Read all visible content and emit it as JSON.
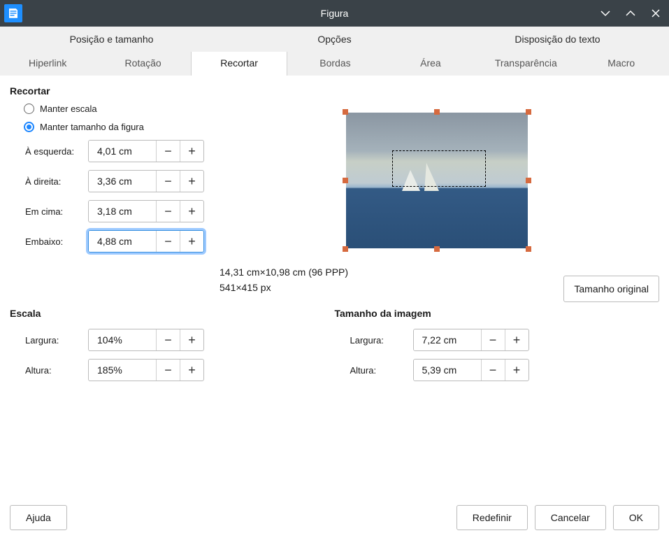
{
  "window": {
    "title": "Figura"
  },
  "tabs": {
    "row1": [
      "Posição e tamanho",
      "Opções",
      "Disposição do texto"
    ],
    "row2": [
      "Hiperlink",
      "Rotação",
      "Recortar",
      "Bordas",
      "Área",
      "Transparência",
      "Macro"
    ],
    "active": "Recortar"
  },
  "crop": {
    "section": "Recortar",
    "keepScale": "Manter escala",
    "keepSize": "Manter tamanho da figura",
    "left": {
      "label": "À esquerda:",
      "value": "4,01 cm"
    },
    "right": {
      "label": "À direita:",
      "value": "3,36 cm"
    },
    "top": {
      "label": "Em cima:",
      "value": "3,18 cm"
    },
    "bottom": {
      "label": "Embaixo:",
      "value": "4,88 cm"
    }
  },
  "info": {
    "dims": "14,31 cm×10,98 cm (96 PPP)",
    "pixels": "541×415 px"
  },
  "originalSize": "Tamanho original",
  "scale": {
    "section": "Escala",
    "width": {
      "label": "Largura:",
      "value": "104%"
    },
    "height": {
      "label": "Altura:",
      "value": "185%"
    }
  },
  "imgSize": {
    "section": "Tamanho da imagem",
    "width": {
      "label": "Largura:",
      "value": "7,22 cm"
    },
    "height": {
      "label": "Altura:",
      "value": "5,39 cm"
    }
  },
  "footer": {
    "help": "Ajuda",
    "reset": "Redefinir",
    "cancel": "Cancelar",
    "ok": "OK"
  }
}
